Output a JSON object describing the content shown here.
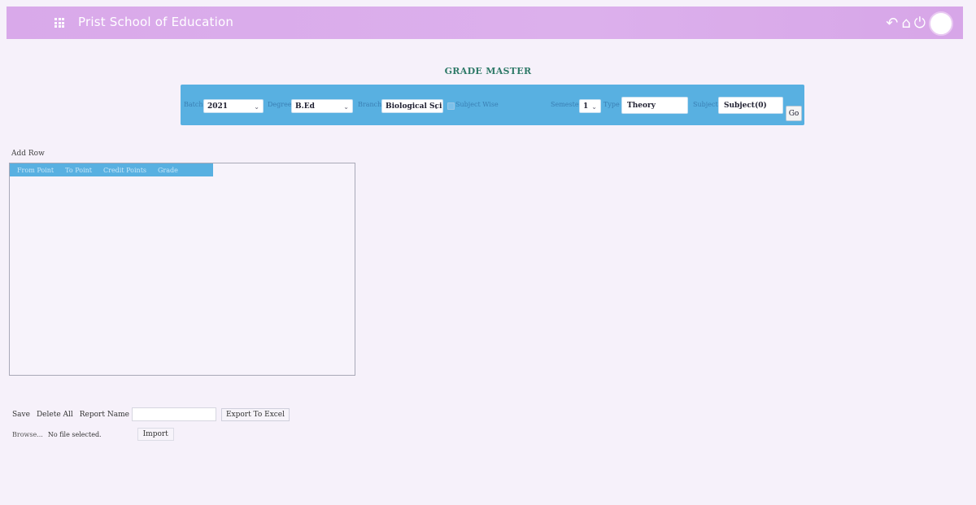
{
  "header": {
    "app_title": "Prist School of Education",
    "icons": [
      "grid-icon",
      "back-icon",
      "home-icon",
      "power-icon",
      "avatar"
    ]
  },
  "page": {
    "heading": "GRADE MASTER"
  },
  "filters": {
    "batch_label": "Batch",
    "batch_value": "2021",
    "degree_label": "Degree",
    "degree_value": "B.Ed",
    "branch_label": "Branch",
    "branch_value": "Biological Sci",
    "subject_wise_label": "Subject Wise",
    "semester_label": "Semester",
    "semester_value": "1",
    "type_label": "Type",
    "type_value": "Theory",
    "subject_label": "Subject",
    "subject_value": "Subject(0)",
    "go_label": "Go"
  },
  "grid": {
    "add_row_label": "Add Row",
    "columns": [
      "From Point",
      "To Point",
      "Credit Points",
      "Grade"
    ]
  },
  "actions": {
    "save_label": "Save",
    "delete_all_label": "Delete All",
    "report_name_label": "Report Name",
    "export_label": "Export To Excel",
    "browse_label": "Browse...",
    "no_file_label": "No file selected.",
    "import_label": "Import"
  },
  "colors": {
    "topbar": "#d9a9ea",
    "filter_bar": "#58b0e1",
    "heading": "#2f7a68",
    "background": "#f6f1fa"
  }
}
